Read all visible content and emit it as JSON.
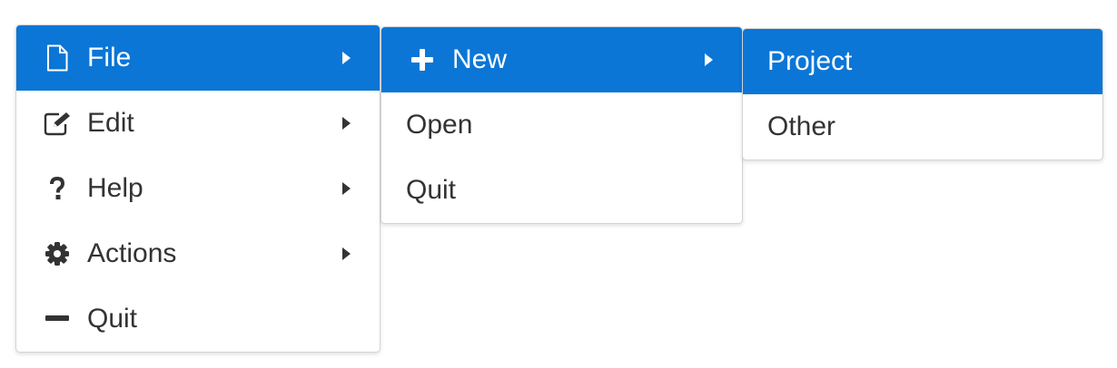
{
  "menus": {
    "main": {
      "items": [
        {
          "label": "File",
          "icon": "file-icon",
          "active": true,
          "has_submenu": true
        },
        {
          "label": "Edit",
          "icon": "edit-icon",
          "active": false,
          "has_submenu": true
        },
        {
          "label": "Help",
          "icon": "help-icon",
          "active": false,
          "has_submenu": true
        },
        {
          "label": "Actions",
          "icon": "gear-icon",
          "active": false,
          "has_submenu": true
        },
        {
          "label": "Quit",
          "icon": "minus-icon",
          "active": false,
          "has_submenu": false
        }
      ]
    },
    "file_submenu": {
      "items": [
        {
          "label": "New",
          "icon": "plus-icon",
          "active": true,
          "has_submenu": true
        },
        {
          "label": "Open",
          "active": false,
          "has_submenu": false
        },
        {
          "label": "Quit",
          "active": false,
          "has_submenu": false
        }
      ]
    },
    "new_submenu": {
      "items": [
        {
          "label": "Project",
          "active": true,
          "has_submenu": false
        },
        {
          "label": "Other",
          "active": false,
          "has_submenu": false
        }
      ]
    }
  },
  "colors": {
    "accent": "#0b76d6",
    "text": "#333333",
    "border": "#d4d4d5",
    "background": "#ffffff"
  }
}
